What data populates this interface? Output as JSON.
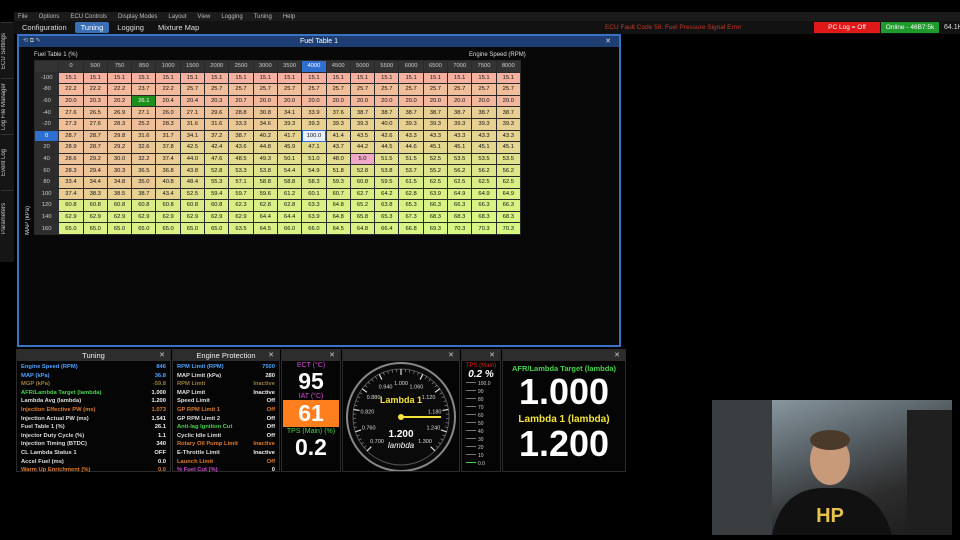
{
  "menu": [
    "File",
    "Options",
    "ECU Controls",
    "Display Modes",
    "Layout",
    "View",
    "Logging",
    "Tuning",
    "Help"
  ],
  "tabs": [
    {
      "label": "Configuration",
      "active": false
    },
    {
      "label": "Tuning",
      "active": true
    },
    {
      "label": "Logging",
      "active": false
    },
    {
      "label": "Mixture Map",
      "active": false
    }
  ],
  "status": {
    "fault": "ECU Fault Code 58: Fuel Pressure Signal Error",
    "pc_log": "PC Log = Off",
    "online": "Online - 46B7:5k",
    "rate": "64.1Hz"
  },
  "sidebar": [
    "ECU Settings",
    "Log File Manager",
    "Event Log",
    "Parameters"
  ],
  "fuel_table": {
    "title": "Fuel Table 1",
    "table_label": "Fuel Table 1 (%)",
    "x_axis_label": "Engine Speed (RPM)",
    "y_axis_label": "MAP (kPa)",
    "rpm": [
      "0",
      "500",
      "750",
      "850",
      "1000",
      "1500",
      "2000",
      "2500",
      "3000",
      "3500",
      "4000",
      "4500",
      "5000",
      "5500",
      "6000",
      "6500",
      "7000",
      "7500",
      "8000"
    ],
    "selected_col": 10,
    "selected_row": 5,
    "rows": [
      {
        "map": "-100",
        "vals": [
          "15.1",
          "15.1",
          "15.1",
          "15.1",
          "15.1",
          "15.1",
          "15.1",
          "15.1",
          "15.1",
          "15.1",
          "15.1",
          "15.1",
          "15.1",
          "15.1",
          "15.1",
          "15.1",
          "15.1",
          "15.1",
          "15.1"
        ]
      },
      {
        "map": "-80",
        "vals": [
          "22.2",
          "22.2",
          "22.2",
          "23.7",
          "22.2",
          "25.7",
          "25.7",
          "25.7",
          "25.7",
          "25.7",
          "25.7",
          "25.7",
          "25.7",
          "25.7",
          "25.7",
          "25.7",
          "25.7",
          "25.7",
          "25.7"
        ]
      },
      {
        "map": "-60",
        "vals": [
          "20.0",
          "20.3",
          "20.2",
          "26.1",
          "20.4",
          "20.4",
          "20.3",
          "20.7",
          "20.0",
          "20.0",
          "20.0",
          "20.0",
          "20.0",
          "20.0",
          "20.0",
          "20.0",
          "20.0",
          "20.0",
          "20.0"
        ]
      },
      {
        "map": "-40",
        "vals": [
          "27.6",
          "26.5",
          "26.9",
          "27.1",
          "26.0",
          "27.1",
          "29.6",
          "28.8",
          "30.8",
          "34.1",
          "33.9",
          "37.6",
          "38.7",
          "38.7",
          "38.7",
          "38.7",
          "38.7",
          "38.7",
          "38.7"
        ]
      },
      {
        "map": "-20",
        "vals": [
          "27.3",
          "27.6",
          "28.3",
          "25.2",
          "28.3",
          "31.6",
          "31.6",
          "33.3",
          "34.6",
          "39.3",
          "39.3",
          "39.3",
          "39.3",
          "40.0",
          "39.3",
          "39.3",
          "39.3",
          "39.3",
          "39.3"
        ]
      },
      {
        "map": "0",
        "vals": [
          "28.7",
          "28.7",
          "29.8",
          "31.6",
          "31.7",
          "34.1",
          "37.2",
          "38.7",
          "40.2",
          "41.7",
          "100.0",
          "41.4",
          "43.5",
          "42.6",
          "43.3",
          "43.3",
          "43.3",
          "43.3",
          "43.3"
        ]
      },
      {
        "map": "20",
        "vals": [
          "28.9",
          "28.7",
          "29.2",
          "32.6",
          "37.8",
          "42.5",
          "42.4",
          "43.6",
          "44.8",
          "45.9",
          "47.1",
          "43.7",
          "44.2",
          "44.5",
          "44.6",
          "45.1",
          "45.1",
          "45.1",
          "45.1"
        ]
      },
      {
        "map": "40",
        "vals": [
          "28.6",
          "29.2",
          "30.0",
          "32.2",
          "37.4",
          "44.0",
          "47.6",
          "48.5",
          "49.3",
          "50.1",
          "51.0",
          "48.0",
          "5.0",
          "51.5",
          "51.5",
          "52.5",
          "53.5",
          "53.5",
          "53.5"
        ]
      },
      {
        "map": "60",
        "vals": [
          "28.3",
          "29.4",
          "30.3",
          "36.5",
          "36.8",
          "43.8",
          "52.8",
          "53.3",
          "53.8",
          "54.4",
          "54.9",
          "51.8",
          "52.8",
          "53.8",
          "53.7",
          "55.2",
          "56.2",
          "56.2",
          "56.2"
        ]
      },
      {
        "map": "80",
        "vals": [
          "33.4",
          "34.4",
          "34.8",
          "35.0",
          "40.8",
          "48.4",
          "55.3",
          "57.1",
          "58.8",
          "58.8",
          "58.3",
          "59.3",
          "60.8",
          "59.5",
          "61.5",
          "62.5",
          "62.5",
          "62.5",
          "62.5"
        ]
      },
      {
        "map": "100",
        "vals": [
          "37.4",
          "38.3",
          "38.5",
          "38.7",
          "43.4",
          "52.5",
          "59.4",
          "59.7",
          "59.6",
          "61.2",
          "60.1",
          "60.7",
          "62.7",
          "64.2",
          "62.8",
          "63.9",
          "64.9",
          "64.9",
          "64.9"
        ]
      },
      {
        "map": "120",
        "vals": [
          "60.8",
          "60.8",
          "60.8",
          "60.8",
          "60.8",
          "60.8",
          "60.8",
          "62.3",
          "62.8",
          "62.8",
          "63.3",
          "64.8",
          "65.2",
          "63.8",
          "65.3",
          "66.3",
          "66.3",
          "66.3",
          "66.3"
        ]
      },
      {
        "map": "140",
        "vals": [
          "62.9",
          "62.9",
          "62.9",
          "62.9",
          "62.9",
          "62.9",
          "62.9",
          "62.9",
          "64.4",
          "64.4",
          "63.9",
          "64.8",
          "65.8",
          "65.3",
          "67.3",
          "68.3",
          "68.3",
          "68.3",
          "68.3"
        ]
      },
      {
        "map": "160",
        "vals": [
          "65.0",
          "65.0",
          "65.0",
          "65.0",
          "65.0",
          "65.0",
          "65.0",
          "63.5",
          "64.5",
          "66.0",
          "66.0",
          "64.5",
          "64.8",
          "66.4",
          "66.8",
          "69.3",
          "70.3",
          "70.3",
          "70.3"
        ]
      }
    ]
  },
  "tuning_panel": {
    "title": "Tuning",
    "rows": [
      {
        "label": "Engine Speed (RPM)",
        "value": "846",
        "color": "#4da3ff"
      },
      {
        "label": "MAP (kPa)",
        "value": "36.8",
        "color": "#4da3ff"
      },
      {
        "label": "MGP (kPa)",
        "value": "-59.8",
        "color": "#9a7c3a"
      },
      {
        "label": "AFR/Lambda Target (lambda)",
        "value": "1.000",
        "color": "#47d34c"
      },
      {
        "label": "Lambda Avg (lambda)",
        "value": "1.200",
        "color": "#dddddd"
      },
      {
        "label": "Injection Effective PW (ms)",
        "value": "1.073",
        "color": "#e07a2a"
      },
      {
        "label": "Injection Actual PW (ms)",
        "value": "1.541",
        "color": "#dddddd"
      },
      {
        "label": "Fuel Table 1 (%)",
        "value": "26.1",
        "color": "#dddddd"
      },
      {
        "label": "Injector Duty Cycle (%)",
        "value": "1.1",
        "color": "#dddddd"
      },
      {
        "label": "Injection Timing (BTDC)",
        "value": "340",
        "color": "#dddddd"
      },
      {
        "label": "CL Lambda Status 1",
        "value": "OFF",
        "color": "#dddddd"
      },
      {
        "label": "Accel Fuel (ms)",
        "value": "0.0",
        "color": "#dddddd"
      },
      {
        "label": "Warm Up Enrichment (%)",
        "value": "0.0",
        "color": "#e07a2a"
      }
    ]
  },
  "protection_panel": {
    "title": "Engine Protection",
    "rows": [
      {
        "label": "RPM Limit (RPM)",
        "value": "7500",
        "color": "#4da3ff"
      },
      {
        "label": "MAP Limit (kPa)",
        "value": "280",
        "color": "#dddddd"
      },
      {
        "label": "RPM Limit",
        "value": "Inactive",
        "color": "#9a7c3a"
      },
      {
        "label": "MAP Limit",
        "value": "Inactive",
        "color": "#dddddd"
      },
      {
        "label": "Speed Limit",
        "value": "Off",
        "color": "#dddddd"
      },
      {
        "label": "GP RPM Limit 1",
        "value": "Off",
        "color": "#e07a2a"
      },
      {
        "label": "GP RPM Limit 2",
        "value": "Off",
        "color": "#dddddd"
      },
      {
        "label": "Anti-lag Ignition Cut",
        "value": "Off",
        "color": "#47d34c"
      },
      {
        "label": "Cyclic Idle Limit",
        "value": "Off",
        "color": "#dddddd"
      },
      {
        "label": "Rotary Oil Pump Limit",
        "value": "Inactive",
        "color": "#e07a2a"
      },
      {
        "label": "E-Throttle Limit",
        "value": "Inactive",
        "color": "#dddddd"
      },
      {
        "label": "Launch Limit",
        "value": "Off",
        "color": "#e07a2a"
      },
      {
        "label": "% Fuel Cut (%)",
        "value": "0",
        "color": "#d04ad0"
      }
    ]
  },
  "gauges": {
    "ect_label": "ECT (°C)",
    "ect_value": "95",
    "iat_label": "IAT (°C)",
    "iat_value": "61",
    "tps_label": "TPS (Main) (%)",
    "tps_value": "0.2",
    "lambda_title": "Lambda 1",
    "lambda_value": "1.200",
    "lambda_unit": "lambda",
    "lambda_ticks": [
      "0.700",
      "0.760",
      "0.820",
      "0.880",
      "0.940",
      "1.000",
      "1.060",
      "1.120",
      "1.180",
      "1.240",
      "1.300"
    ],
    "tps_bar_label": "TPS (Main)",
    "tps_bar_value": "0.2 %",
    "tps_bar_fraction": 0.002,
    "tps_ticks": [
      "100.0",
      "90",
      "80",
      "70",
      "60",
      "50",
      "40",
      "30",
      "20",
      "10",
      "0.0"
    ],
    "afr_target_label": "AFR/Lambda Target (lambda)",
    "afr_target_value": "1.000",
    "lambda1_label": "Lambda 1 (lambda)",
    "lambda1_value": "1.200"
  },
  "colors": {
    "accent": "#3a72c4",
    "green": "#47d34c",
    "red": "#e01818",
    "orange_bg": "#ff7f1e"
  }
}
